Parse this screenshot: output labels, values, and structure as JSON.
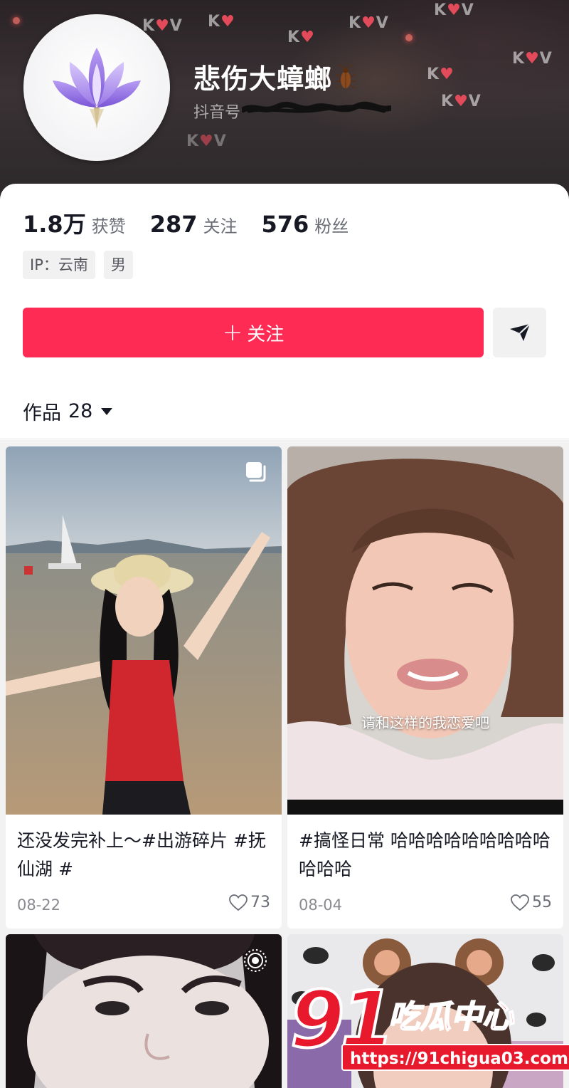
{
  "profile": {
    "username": "悲伤大蟑螂",
    "douyin_id_label": "抖音号"
  },
  "stats": {
    "likes_value": "1.8万",
    "likes_label": "获赞",
    "following_value": "287",
    "following_label": "关注",
    "followers_value": "576",
    "followers_label": "粉丝"
  },
  "tags": {
    "ip": "IP：云南",
    "gender": "男"
  },
  "actions": {
    "follow_plus": "+",
    "follow_label": "关注",
    "message_icon": "send-icon"
  },
  "works": {
    "label": "作品",
    "count": "28"
  },
  "posts": [
    {
      "caption": "还没发完补上～#出游碎片 #抚仙湖 #",
      "date": "08-22",
      "likes": "73",
      "corner_icon": "multi-image-icon"
    },
    {
      "caption": "#搞怪日常 哈哈哈哈哈哈哈哈哈哈哈哈",
      "subtitle": "请和这样的我恋爱吧",
      "date": "08-04",
      "likes": "55"
    },
    {
      "corner_icon": "live-photo-icon"
    },
    {}
  ],
  "watermark": {
    "number": "91",
    "text": "吃瓜中心",
    "url": "https://91chigua03.com"
  },
  "colors": {
    "accent": "#fe2c55",
    "watermark_red": "#e8192c"
  }
}
